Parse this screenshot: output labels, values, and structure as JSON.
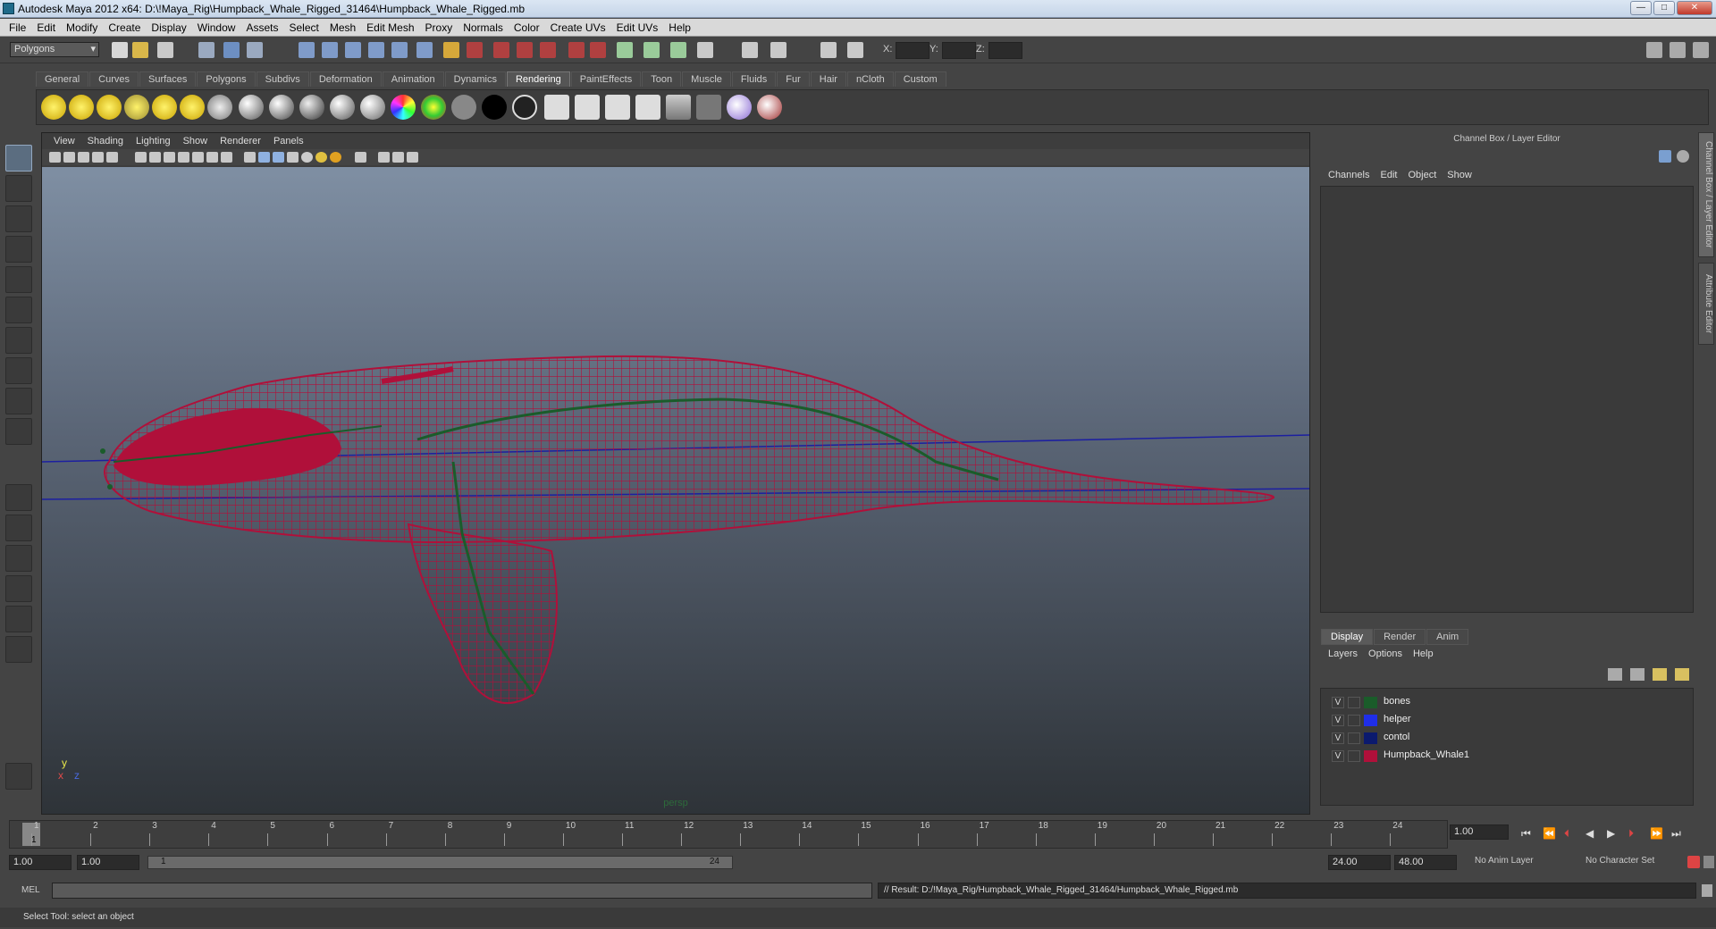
{
  "window": {
    "title": "Autodesk Maya 2012 x64: D:\\!Maya_Rig\\Humpback_Whale_Rigged_31464\\Humpback_Whale_Rigged.mb",
    "min": "—",
    "max": "□",
    "close": "✕"
  },
  "menubar": [
    "File",
    "Edit",
    "Modify",
    "Create",
    "Display",
    "Window",
    "Assets",
    "Select",
    "Mesh",
    "Edit Mesh",
    "Proxy",
    "Normals",
    "Color",
    "Create UVs",
    "Edit UVs",
    "Help"
  ],
  "statusline": {
    "mode": "Polygons",
    "x_label": "X:",
    "y_label": "Y:",
    "z_label": "Z:"
  },
  "shelf": {
    "tabs": [
      "General",
      "Curves",
      "Surfaces",
      "Polygons",
      "Subdivs",
      "Deformation",
      "Animation",
      "Dynamics",
      "Rendering",
      "PaintEffects",
      "Toon",
      "Muscle",
      "Fluids",
      "Fur",
      "Hair",
      "nCloth",
      "Custom"
    ],
    "active": "Rendering"
  },
  "viewport": {
    "menu": [
      "View",
      "Shading",
      "Lighting",
      "Show",
      "Renderer",
      "Panels"
    ],
    "camera": "persp",
    "axis_y": "y",
    "axis_x": "x",
    "axis_z": "z"
  },
  "channelbox": {
    "title": "Channel Box / Layer Editor",
    "menu": [
      "Channels",
      "Edit",
      "Object",
      "Show"
    ],
    "layer_tabs": [
      "Display",
      "Render",
      "Anim"
    ],
    "layer_menu": [
      "Layers",
      "Options",
      "Help"
    ],
    "layers": [
      {
        "vis": "V",
        "name": "bones",
        "color": "#1a5c2a"
      },
      {
        "vis": "V",
        "name": "helper",
        "color": "#1f2ee8"
      },
      {
        "vis": "V",
        "name": "contol",
        "color": "#0b1a6e"
      },
      {
        "vis": "V",
        "name": "Humpback_Whale1",
        "color": "#b0103a"
      }
    ],
    "side_tabs": [
      "Channel Box / Layer Editor",
      "Attribute Editor"
    ]
  },
  "timeline": {
    "ticks": [
      "1",
      "2",
      "3",
      "4",
      "5",
      "6",
      "7",
      "8",
      "9",
      "10",
      "11",
      "12",
      "13",
      "14",
      "15",
      "16",
      "17",
      "18",
      "19",
      "20",
      "21",
      "22",
      "23",
      "24"
    ],
    "current_marker": "1",
    "current_frame": "1.00"
  },
  "range": {
    "start": "1.00",
    "anim_start": "1.00",
    "slider_start": "1",
    "slider_end": "24",
    "end": "24.00",
    "anim_end": "48.00",
    "anim_layer": "No Anim Layer",
    "char_set": "No Character Set"
  },
  "cmdline": {
    "lang": "MEL",
    "result": "// Result: D:/!Maya_Rig/Humpback_Whale_Rigged_31464/Humpback_Whale_Rigged.mb"
  },
  "help_line": "Select Tool: select an object",
  "colors": {
    "wireframe": "#b0103a",
    "bones": "#1a5c2a",
    "ground_line": "#1c1fa0"
  }
}
